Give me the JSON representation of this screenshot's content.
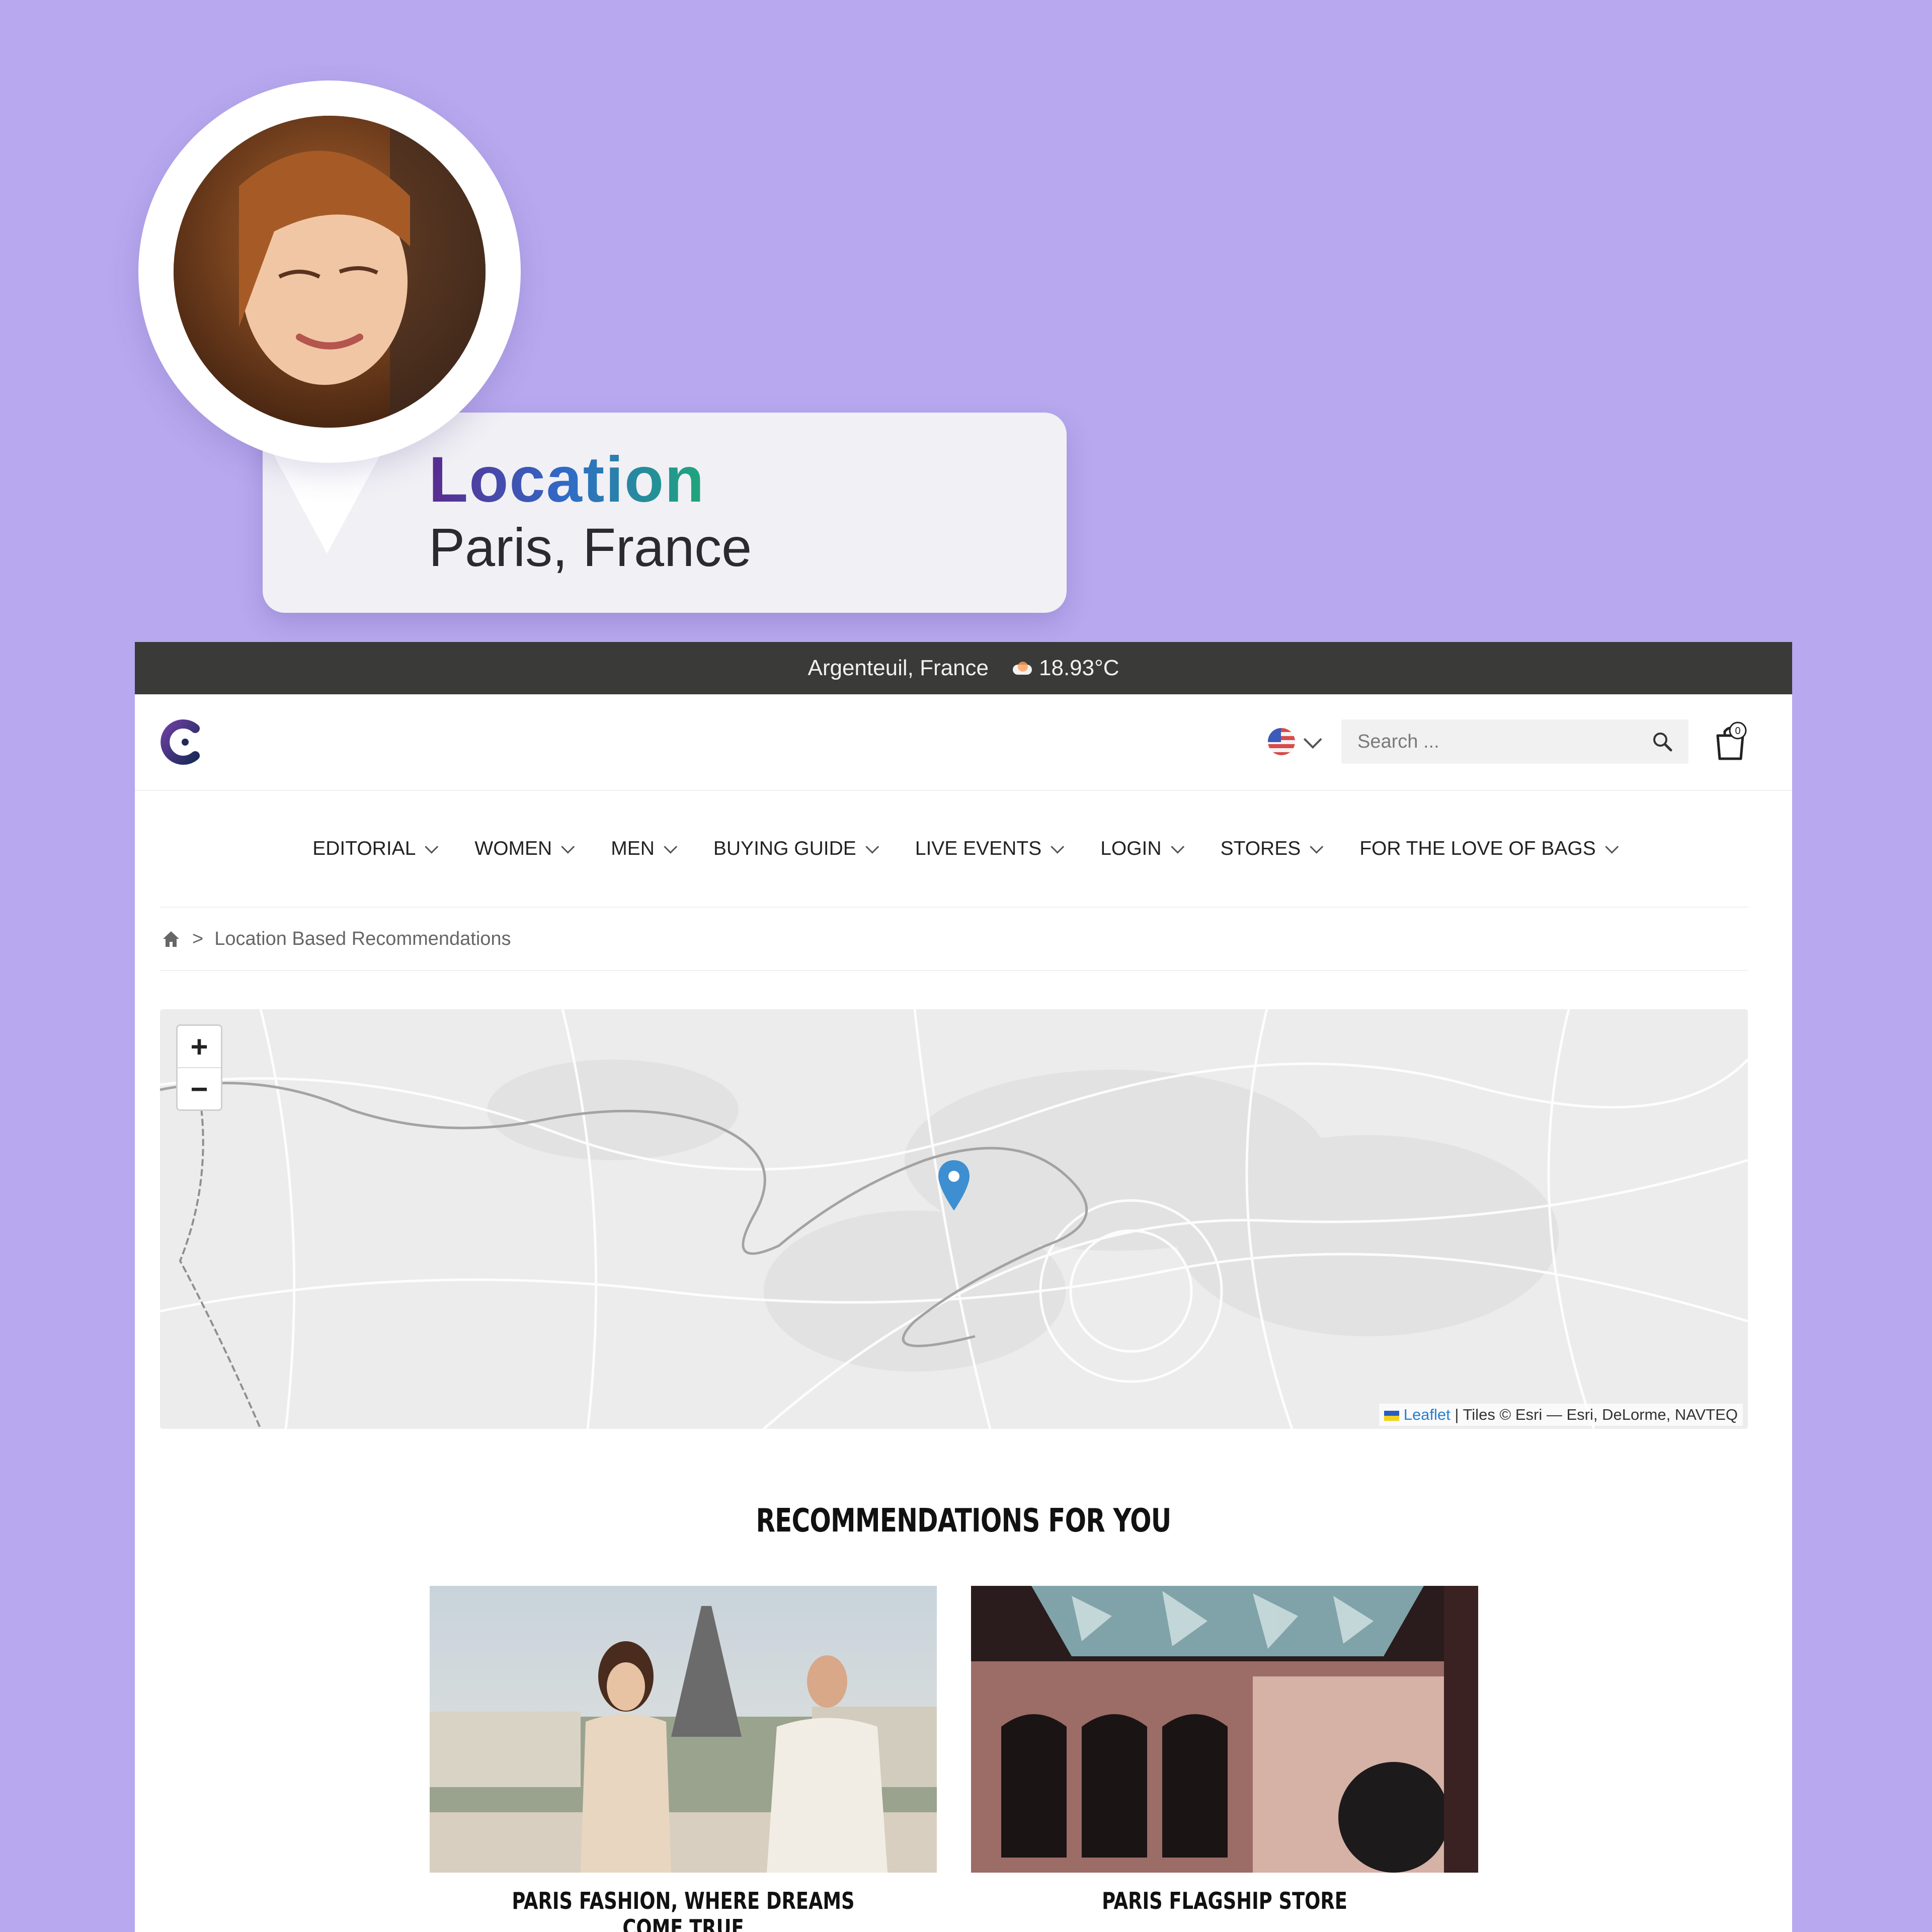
{
  "profile": {
    "location_label": "Location",
    "location_value": "Paris, France"
  },
  "topbar": {
    "city": "Argenteuil, France",
    "weather_icon": "cloud-icon",
    "temperature": "18.93°C"
  },
  "header": {
    "logo": "brand-logo-icon",
    "language_icon": "us-flag-icon",
    "search_placeholder": "Search ...",
    "cart_count": "0"
  },
  "nav": {
    "items": [
      {
        "label": "EDITORIAL"
      },
      {
        "label": "WOMEN"
      },
      {
        "label": "MEN"
      },
      {
        "label": "BUYING GUIDE"
      },
      {
        "label": "LIVE EVENTS"
      },
      {
        "label": "LOGIN"
      },
      {
        "label": "STORES"
      },
      {
        "label": "FOR THE LOVE OF BAGS"
      }
    ]
  },
  "breadcrumb": {
    "separator": ">",
    "current": "Location Based Recommendations"
  },
  "map": {
    "zoom_in": "+",
    "zoom_out": "−",
    "attribution_link": "Leaflet",
    "attribution_text": "| Tiles © Esri — Esri, DeLorme, NAVTEQ",
    "marker_color": "#3d8fd1"
  },
  "recommendations": {
    "title": "RECOMMENDATIONS FOR YOU",
    "items": [
      {
        "title": "PARIS FASHION, WHERE DREAMS COME TRUE"
      },
      {
        "title": "PARIS FLAGSHIP STORE"
      }
    ]
  }
}
